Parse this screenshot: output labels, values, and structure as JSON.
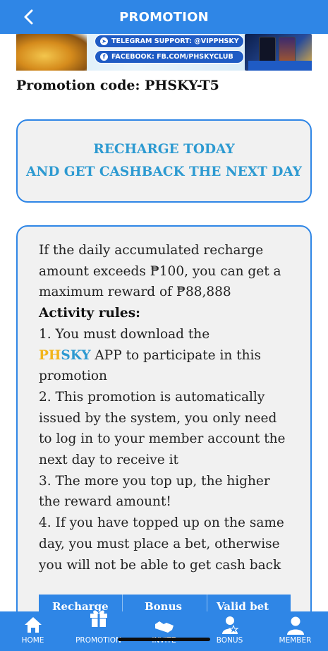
{
  "header": {
    "title": "PROMOTION",
    "back_icon": "chevron-left-icon"
  },
  "banner": {
    "telegram": "TELEGRAM SUPPORT: @VIPPHSKY",
    "facebook": "FACEBOOK: FB.COM/PHSKYCLUB"
  },
  "promo_code": "Promotion code: PHSKY-T5",
  "title_box": {
    "line1": "RECHARGE TODAY",
    "line2": "AND GET CASHBACK THE NEXT DAY"
  },
  "rules": {
    "intro_lines": [
      "If the daily accumulated recharge",
      "amount exceeds ₱100, you can get a",
      "maximum reward of ₱88,888"
    ],
    "heading": "Activity rules:",
    "r1_a": "1. You must download the",
    "brand_ph": "PH",
    "brand_sky": "SKY",
    "r1_b": " APP to participate in this",
    "r1_c": "promotion",
    "r2_lines": [
      "2. This promotion is automatically",
      "issued by the system, you only need",
      "to log in to your member account the",
      "next day to receive it"
    ],
    "r3_lines": [
      "3. The more you top up, the higher",
      "the reward amount!"
    ],
    "r4_lines": [
      "4. If you have topped up on the same",
      "day, you must place a bet, otherwise",
      "you will not be able to get cash back"
    ]
  },
  "table": {
    "col1": "Recharge",
    "col2": "Bonus",
    "col3": "Valid bet"
  },
  "nav": {
    "home": "HOME",
    "promotion": "PROMOTION",
    "invite": "INVITE",
    "bonus": "BONUS",
    "member": "MEMBER"
  },
  "colors": {
    "primary": "#2f86e6",
    "title_text": "#2d9ad1",
    "brand_gold": "#f2b51a"
  }
}
